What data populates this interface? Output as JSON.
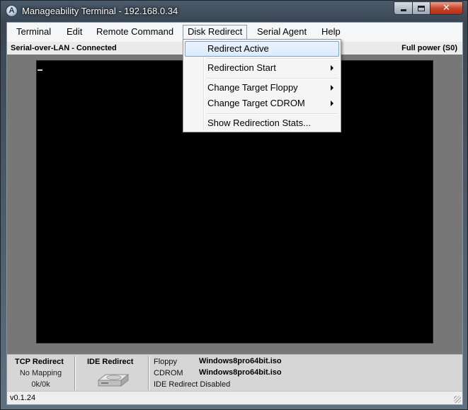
{
  "window": {
    "title": "Manageability Terminal - 192.168.0.34",
    "icon_letter": "A",
    "close_glyph": "✕"
  },
  "menu": {
    "items": [
      {
        "label": "Terminal"
      },
      {
        "label": "Edit"
      },
      {
        "label": "Remote Command"
      },
      {
        "label": "Disk Redirect"
      },
      {
        "label": "Serial Agent"
      },
      {
        "label": "Help"
      }
    ]
  },
  "status": {
    "connection": "Serial-over-LAN - Connected",
    "power": "Full power (S0)"
  },
  "dropdown": {
    "items": [
      {
        "label": "Redirect Active"
      },
      {
        "label": "Redirection Start"
      },
      {
        "label": "Change Target Floppy"
      },
      {
        "label": "Change Target CDROM"
      },
      {
        "label": "Show Redirection Stats..."
      }
    ]
  },
  "bottom": {
    "tcp_title": "TCP Redirect",
    "tcp_mapping": "No Mapping",
    "tcp_rate": "0k/0k",
    "ide_title": "IDE Redirect",
    "floppy_label": "Floppy",
    "floppy_value": "Windows8pro64bit.iso",
    "cdrom_label": "CDROM",
    "cdrom_value": "Windows8pro64bit.iso",
    "ide_status": "IDE Redirect Disabled"
  },
  "version": "v0.1.24"
}
